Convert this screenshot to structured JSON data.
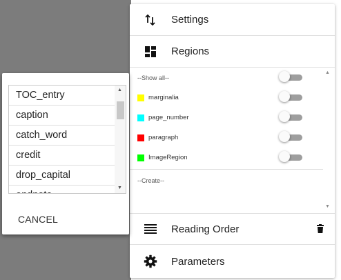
{
  "menu": {
    "settings_label": "Settings",
    "regions_label": "Regions",
    "reading_order_label": "Reading Order",
    "parameters_label": "Parameters"
  },
  "regions": {
    "show_all_label": "--Show all--",
    "create_label": "--Create--",
    "items": [
      {
        "name": "marginalia",
        "color": "#ffff00",
        "enabled": false
      },
      {
        "name": "page_number",
        "color": "#00ffff",
        "enabled": false
      },
      {
        "name": "paragraph",
        "color": "#ff0000",
        "enabled": false
      },
      {
        "name": "ImageRegion",
        "color": "#00ff00",
        "enabled": false
      }
    ]
  },
  "dialog": {
    "options": [
      "TOC_entry",
      "caption",
      "catch_word",
      "credit",
      "drop_capital",
      "endnote"
    ],
    "cancel_label": "CANCEL"
  },
  "colors": {
    "background_grey": "#7c7c7c",
    "toggle_off": "#9e9e9e"
  }
}
